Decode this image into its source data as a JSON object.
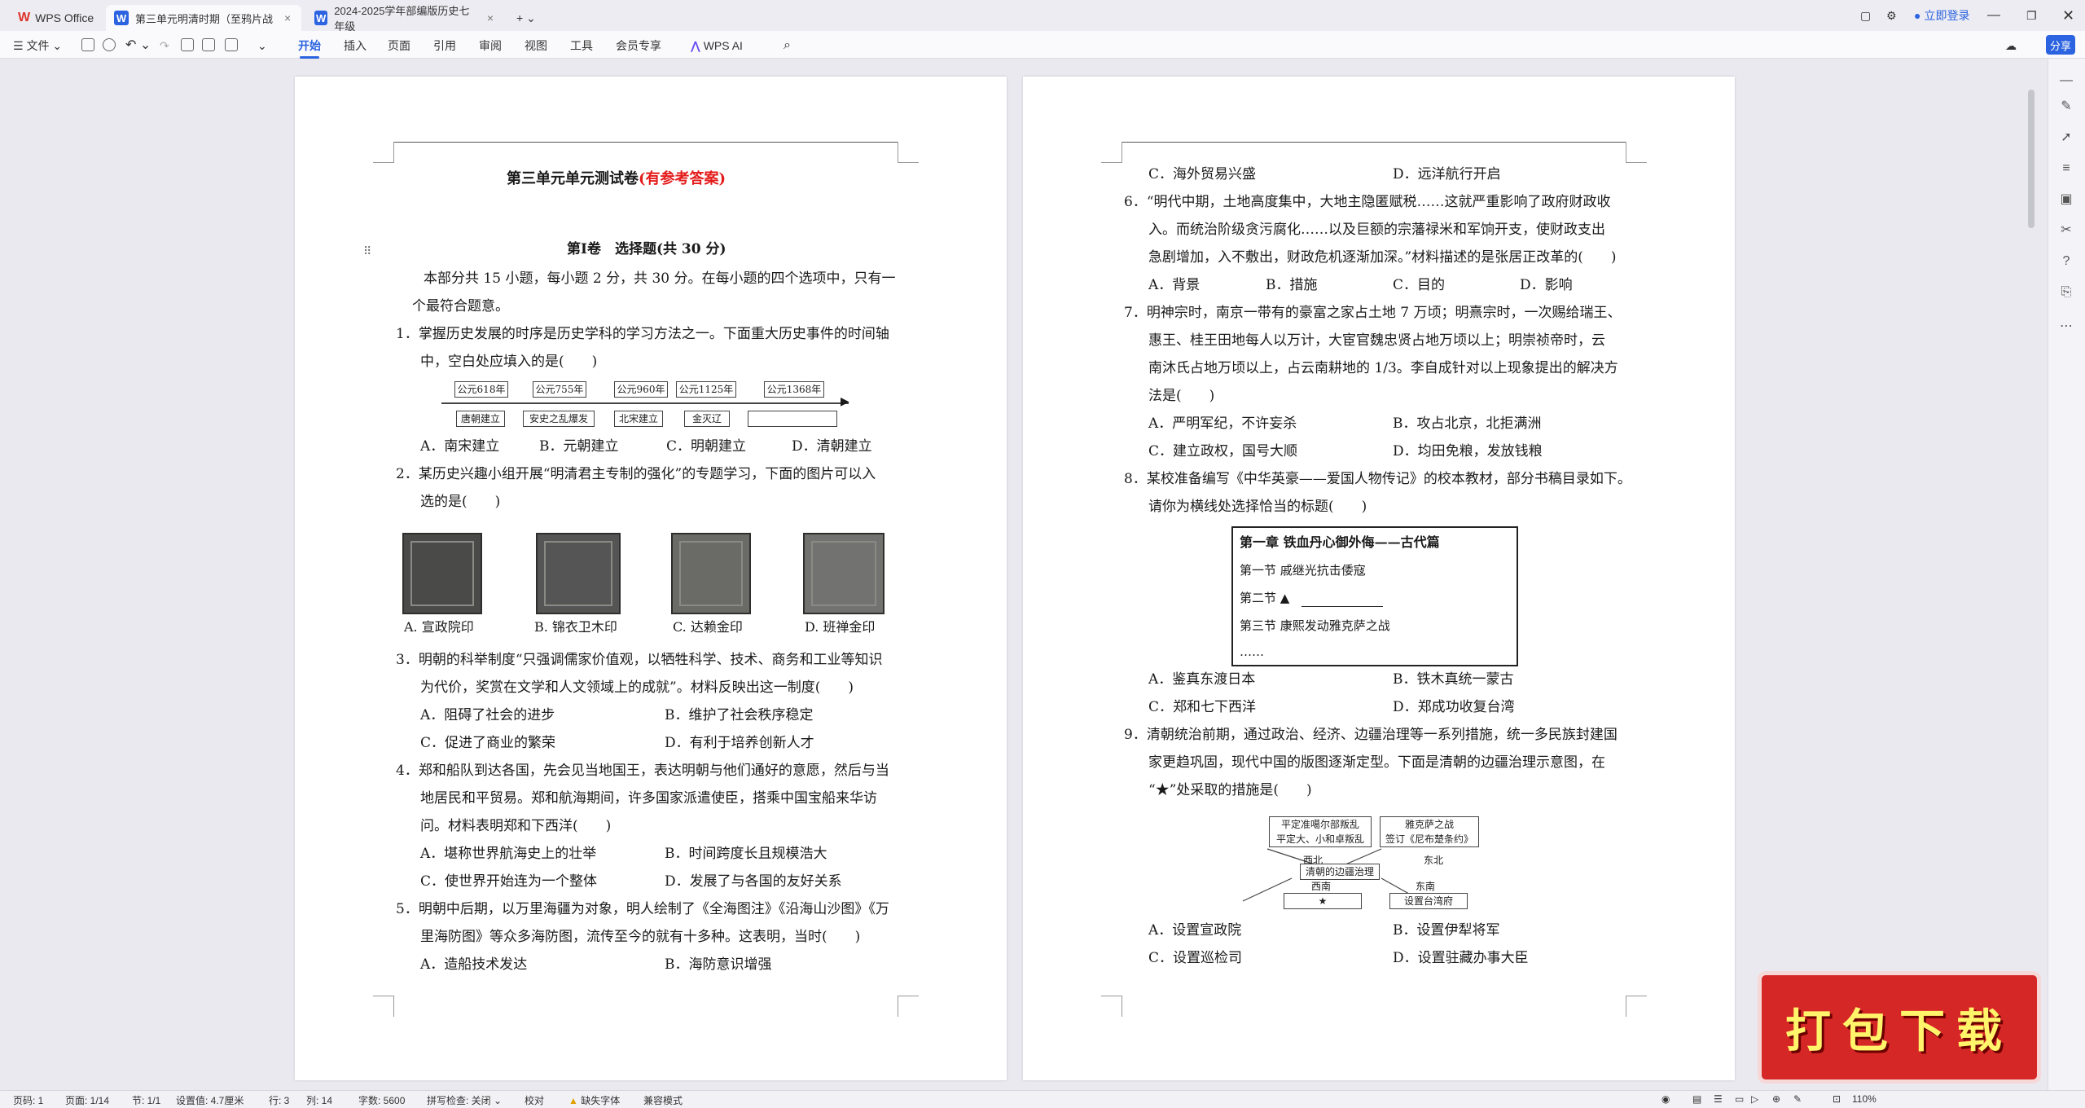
{
  "app": {
    "name": "WPS Office"
  },
  "tabs": [
    {
      "label": "第三单元明清时期（至鸦片战"
    },
    {
      "label": "2024-2025学年部编版历史七年级"
    }
  ],
  "topbar": {
    "login": "立即登录"
  },
  "ribbon": {
    "file": "文件",
    "tabs": [
      "开始",
      "插入",
      "页面",
      "引用",
      "审阅",
      "视图",
      "工具",
      "会员专享"
    ],
    "ai": "WPS AI",
    "share": "分享"
  },
  "page1": {
    "title": "第三单元单元测试卷",
    "title_suffix": "(有参考答案)",
    "section": "第Ⅰ卷　选择题(共 30 分)",
    "intro": [
      "本部分共 15 小题，每小题 2 分，共 30 分。在每小题的四个选项中，只有一",
      "个最符合题意。"
    ],
    "q1": [
      "1．掌握历史发展的时序是历史学科的学习方法之一。下面重大历史事件的时间轴",
      "中，空白处应填入的是(　　)"
    ],
    "timeline": {
      "years": [
        "公元618年",
        "公元755年",
        "公元960年",
        "公元1125年",
        "公元1368年"
      ],
      "events": [
        "唐朝建立",
        "安史之乱爆发",
        "北宋建立",
        "金灭辽",
        ""
      ]
    },
    "q1opts": [
      "A．南宋建立",
      "B．元朝建立",
      "C．明朝建立",
      "D．清朝建立"
    ],
    "q2": [
      "2．某历史兴趣小组开展“明清君主专制的强化”的专题学习，下面的图片可以入",
      "选的是(　　)"
    ],
    "seals": [
      "A. 宣政院印",
      "B. 锦衣卫木印",
      "C. 达赖金印",
      "D. 班禅金印"
    ],
    "q3": [
      "3．明朝的科举制度“只强调儒家价值观，以牺牲科学、技术、商务和工业等知识",
      "为代价，奖赏在文学和人文领域上的成就”。材料反映出这一制度(　　)"
    ],
    "q3opts": [
      "A．阻碍了社会的进步",
      "B．维护了社会秩序稳定",
      "C．促进了商业的繁荣",
      "D．有利于培养创新人才"
    ],
    "q4": [
      "4．郑和船队到达各国，先会见当地国王，表达明朝与他们通好的意愿，然后与当",
      "地居民和平贸易。郑和航海期间，许多国家派遣使臣，搭乘中国宝船来华访",
      "问。材料表明郑和下西洋(　　)"
    ],
    "q4opts": [
      "A．堪称世界航海史上的壮举",
      "B．时间跨度长且规模浩大",
      "C．使世界开始连为一个整体",
      "D．发展了与各国的友好关系"
    ],
    "q5": [
      "5．明朝中后期，以万里海疆为对象，明人绘制了《全海图注》《沿海山沙图》《万",
      "里海防图》等众多海防图，流传至今的就有十多种。这表明，当时(　　)"
    ],
    "q5opts": [
      "A．造船技术发达",
      "B．海防意识增强"
    ]
  },
  "page2": {
    "q5opts": [
      "C．海外贸易兴盛",
      "D．远洋航行开启"
    ],
    "q6": [
      "6．“明代中期，土地高度集中，大地主隐匿赋税……这就严重影响了政府财政收",
      "入。而统治阶级贪污腐化……以及巨额的宗藩禄米和军饷开支，使财政支出",
      "急剧增加，入不敷出，财政危机逐渐加深。”材料描述的是张居正改革的(　　)"
    ],
    "q6opts": [
      "A．背景",
      "B．措施",
      "C．目的",
      "D．影响"
    ],
    "q7": [
      "7．明神宗时，南京一带有的豪富之家占土地 7 万顷；明熹宗时，一次赐给瑞王、",
      "惠王、桂王田地每人以万计，大宦官魏忠贤占地万顷以上；明崇祯帝时，云",
      "南沐氏占地万顷以上，占云南耕地的 1/3。李自成针对以上现象提出的解决方",
      "法是(　　)"
    ],
    "q7opts": [
      "A．严明军纪，不许妄杀",
      "B．攻占北京，北拒满洲",
      "C．建立政权，国号大顺",
      "D．均田免粮，发放钱粮"
    ],
    "q8": [
      "8．某校准备编写《中华英豪——爱国人物传记》的校本教材，部分书稿目录如下。",
      "请你为横线处选择恰当的标题(　　)"
    ],
    "chapter": {
      "title": "第一章  铁血丹心御外侮——古代篇",
      "s1": "第一节  戚继光抗击倭寇",
      "s2": "第二节  ▲",
      "s3": "第三节  康熙发动雅克萨之战",
      "more": "……"
    },
    "q8opts": [
      "A．鉴真东渡日本",
      "B．铁木真统一蒙古",
      "C．郑和七下西洋",
      "D．郑成功收复台湾"
    ],
    "q9": [
      "9．清朝统治前期，通过政治、经济、边疆治理等一系列措施，统一多民族封建国",
      "家更趋巩固，现代中国的版图逐渐定型。下面是清朝的边疆治理示意图，在",
      "“★”处采取的措施是(　　)"
    ],
    "diagram": {
      "nw": [
        "平定准噶尔部叛乱",
        "平定大、小和卓叛乱"
      ],
      "ne": [
        "雅克萨之战",
        "签订《尼布楚条约》"
      ],
      "center": "清朝的边疆治理",
      "labels": [
        "西北",
        "东北",
        "西南",
        "东南"
      ],
      "star": "★",
      "se": "设置台湾府"
    },
    "q9opts": [
      "A．设置宣政院",
      "B．设置伊犁将军",
      "C．设置巡检司",
      "D．设置驻藏办事大臣"
    ]
  },
  "status": {
    "items": [
      "页码: 1",
      "页面: 1/14",
      "节: 1/1",
      "设置值: 4.7厘米",
      "行: 3",
      "列: 14",
      "字数: 5600",
      "拼写检查: 关闭",
      "校对",
      "缺失字体",
      "兼容模式"
    ],
    "zoom": "110%"
  },
  "promo": "打包下载"
}
